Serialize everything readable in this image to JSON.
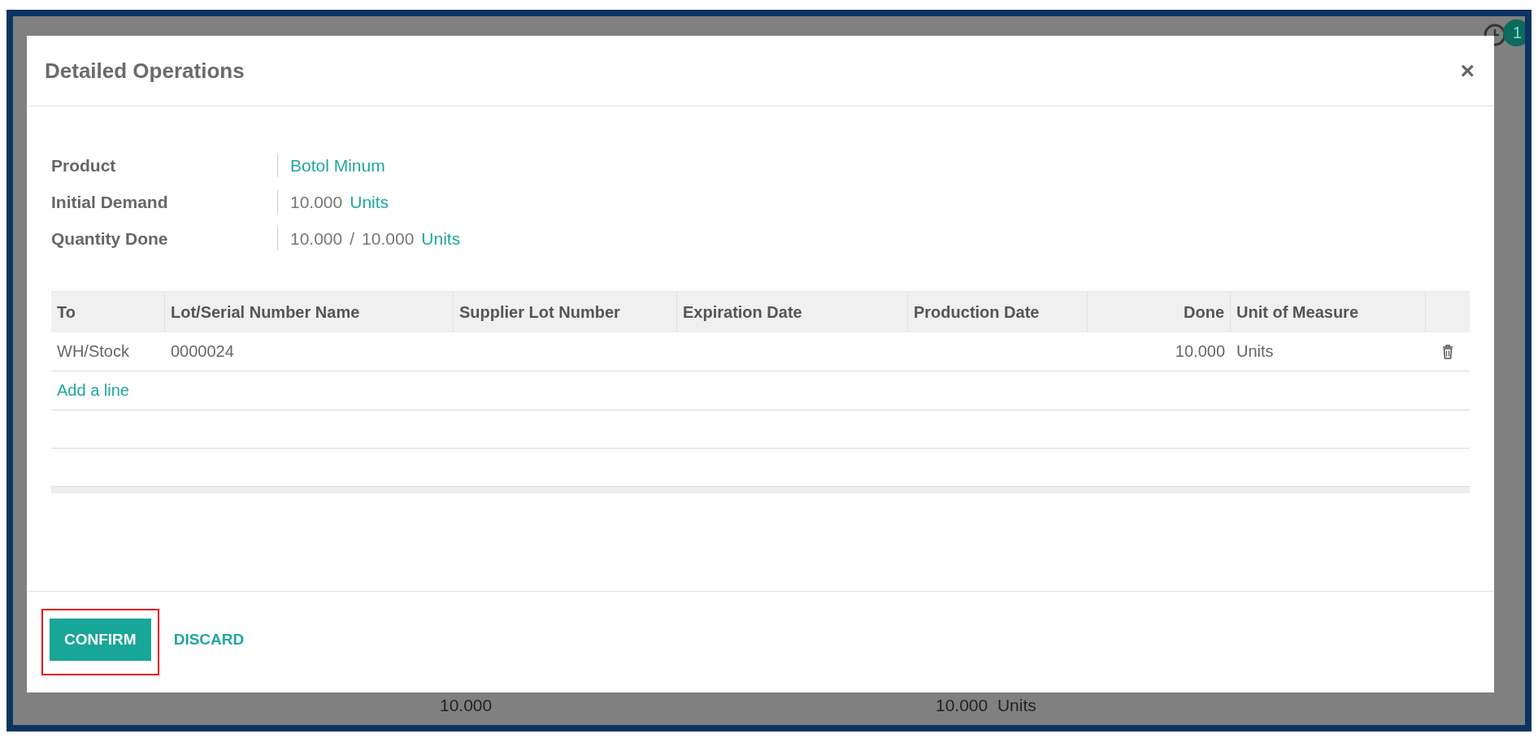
{
  "background": {
    "badge": "1",
    "totals": [
      "10.000",
      "10.000  Units"
    ]
  },
  "dialog": {
    "title": "Detailed Operations",
    "close": "×",
    "fields": [
      {
        "label": "Product",
        "parts": [
          {
            "text": "Botol Minum",
            "link": true
          }
        ]
      },
      {
        "label": "Initial Demand",
        "parts": [
          {
            "text": "10.000",
            "link": false
          },
          {
            "text": "Units",
            "link": true
          }
        ]
      },
      {
        "label": "Quantity Done",
        "parts": [
          {
            "text": "10.000",
            "link": false
          },
          {
            "text": "/",
            "link": false
          },
          {
            "text": "10.000",
            "link": false
          },
          {
            "text": "Units",
            "link": true
          }
        ]
      }
    ],
    "table": {
      "columns": [
        {
          "label": "To",
          "kind": "text"
        },
        {
          "label": "Lot/Serial Number Name",
          "kind": "text"
        },
        {
          "label": "Supplier Lot Number",
          "kind": "text"
        },
        {
          "label": "Expiration Date",
          "kind": "text"
        },
        {
          "label": "Production Date",
          "kind": "text"
        },
        {
          "label": "Done",
          "kind": "number"
        },
        {
          "label": "Unit of Measure",
          "kind": "text"
        }
      ],
      "rows": [
        {
          "cells": [
            "WH/Stock",
            "0000024",
            "",
            "",
            "",
            "10.000",
            "Units"
          ]
        }
      ],
      "add_line": "Add a line"
    },
    "buttons": [
      {
        "label": "CONFIRM",
        "kind": "primary",
        "highlighted": true
      },
      {
        "label": "DISCARD",
        "kind": "link",
        "highlighted": false
      }
    ]
  }
}
